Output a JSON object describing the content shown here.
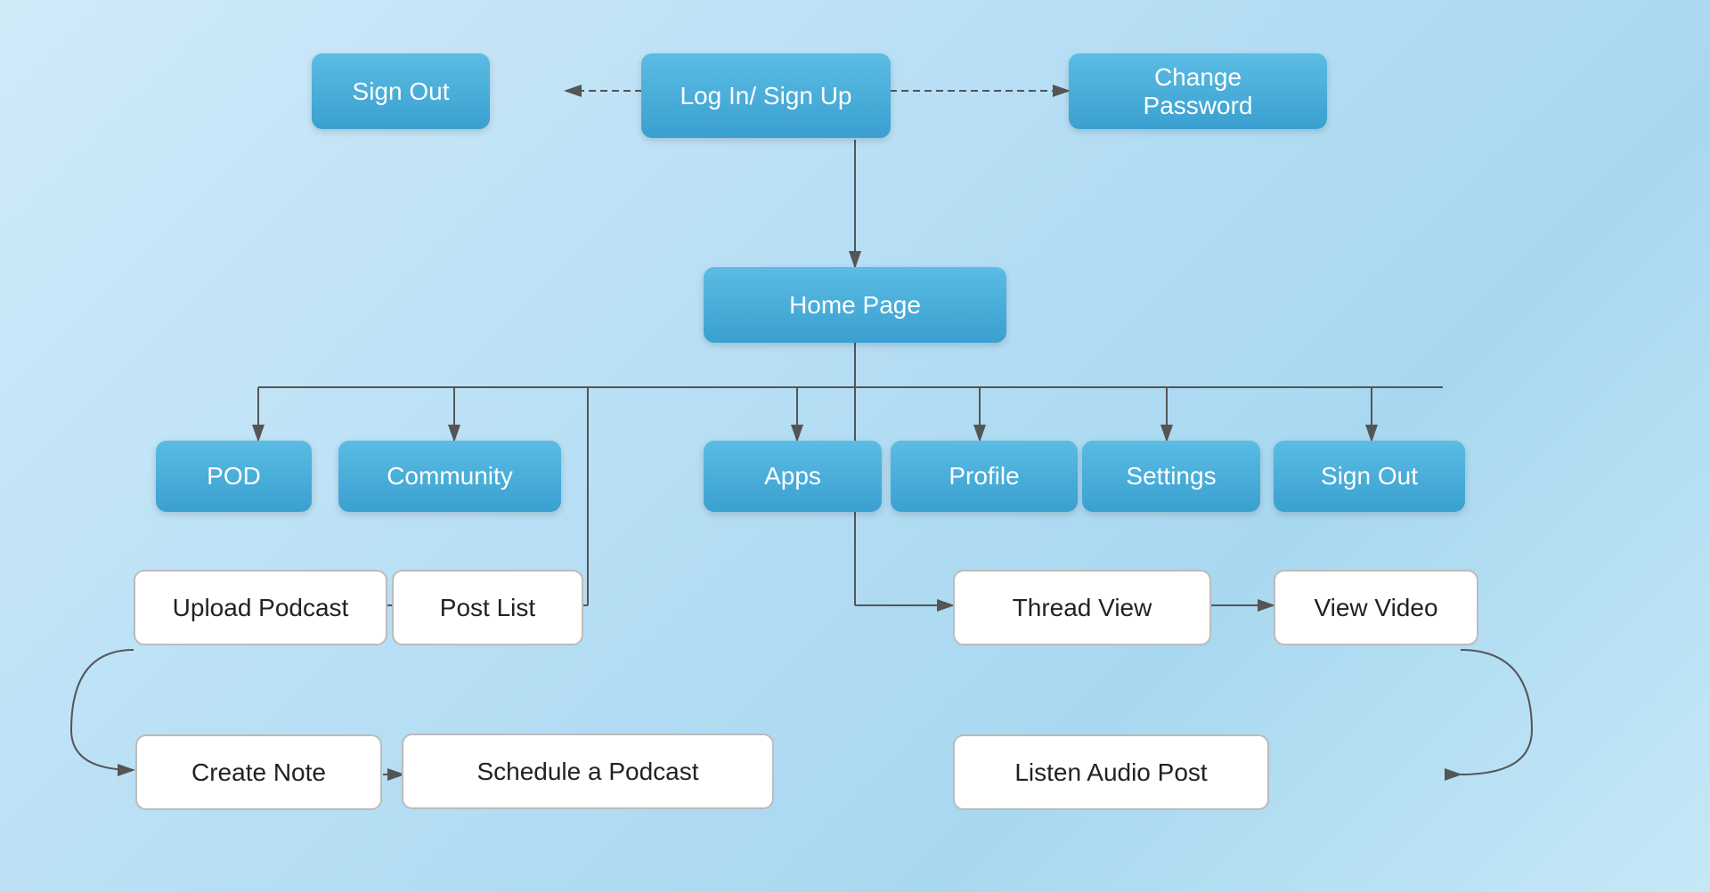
{
  "nodes": {
    "login": {
      "label": "Log In/ Sign Up"
    },
    "signout_top": {
      "label": "Sign Out"
    },
    "change_password": {
      "label": "Change Password"
    },
    "home_page": {
      "label": "Home Page"
    },
    "pod": {
      "label": "POD"
    },
    "community": {
      "label": "Community"
    },
    "apps": {
      "label": "Apps"
    },
    "profile": {
      "label": "Profile"
    },
    "settings": {
      "label": "Settings"
    },
    "signout_bottom": {
      "label": "Sign Out"
    },
    "upload_podcast": {
      "label": "Upload Podcast"
    },
    "post_list": {
      "label": "Post List"
    },
    "thread_view": {
      "label": "Thread View"
    },
    "view_video": {
      "label": "View Video"
    },
    "create_note": {
      "label": "Create Note"
    },
    "schedule_podcast": {
      "label": "Schedule a Podcast"
    },
    "listen_audio": {
      "label": "Listen Audio Post"
    }
  }
}
